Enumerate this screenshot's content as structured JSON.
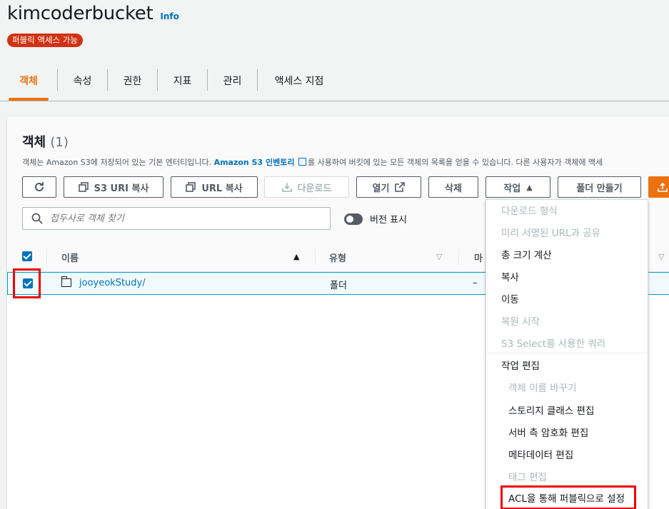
{
  "bucket": {
    "name": "kimcoderbucket",
    "info": "Info",
    "badge": "퍼블릭 액세스 가능"
  },
  "tabs": [
    {
      "label": "객체",
      "active": true
    },
    {
      "label": "속성"
    },
    {
      "label": "권한"
    },
    {
      "label": "지표"
    },
    {
      "label": "관리"
    },
    {
      "label": "액세스 지점"
    }
  ],
  "objects": {
    "title": "객체",
    "count": "(1)",
    "description": {
      "before": "객체는 Amazon S3에 저장되어 있는 기본 엔터티입니다. ",
      "link": "Amazon S3 인벤토리",
      "after": "를 사용하여 버킷에 있는 모든 객체의 목록을 얻을 수 있습니다. 다른 사용자가 객체에 액세"
    },
    "buttons": {
      "refresh": "refresh-icon",
      "copy_s3_uri": "S3 URI 복사",
      "copy_url": "URL 복사",
      "download": "다운로드",
      "open": "열기",
      "delete": "삭제",
      "actions": "작업",
      "create_folder": "폴더 만들기"
    },
    "search_placeholder": "접두사로 객체 찾기",
    "show_versions": "버전 표시",
    "columns": {
      "name": "이름",
      "type": "유형",
      "modified_partial": "마"
    },
    "rows": [
      {
        "name": "jooyeokStudy/",
        "type": "폴더",
        "modified": "–"
      }
    ]
  },
  "actions_menu": {
    "items": [
      {
        "label": "다운로드 형식",
        "disabled": true
      },
      {
        "label": "미리 서명된 URL과 공유",
        "disabled": true
      },
      {
        "label": "총 크기 계산"
      },
      {
        "label": "복사"
      },
      {
        "label": "이동"
      },
      {
        "label": "복원 시작",
        "disabled": true
      },
      {
        "label": "S3 Select를 사용한 쿼리",
        "disabled": true
      }
    ],
    "edit_group": "작업 편집",
    "edit_items": [
      {
        "label": "객체 이름 바꾸기",
        "disabled": true
      },
      {
        "label": "스토리지 클래스 편집"
      },
      {
        "label": "서버 측 암호화 편집"
      },
      {
        "label": "메타데이터 편집"
      },
      {
        "label": "태그 편집",
        "disabled": true
      },
      {
        "label": "ACL을 통해 퍼블릭으로 설정"
      }
    ]
  },
  "colors": {
    "accent": "#ec7211",
    "link": "#0073bb",
    "badge": "#d13212",
    "highlight": "#ee0000"
  }
}
